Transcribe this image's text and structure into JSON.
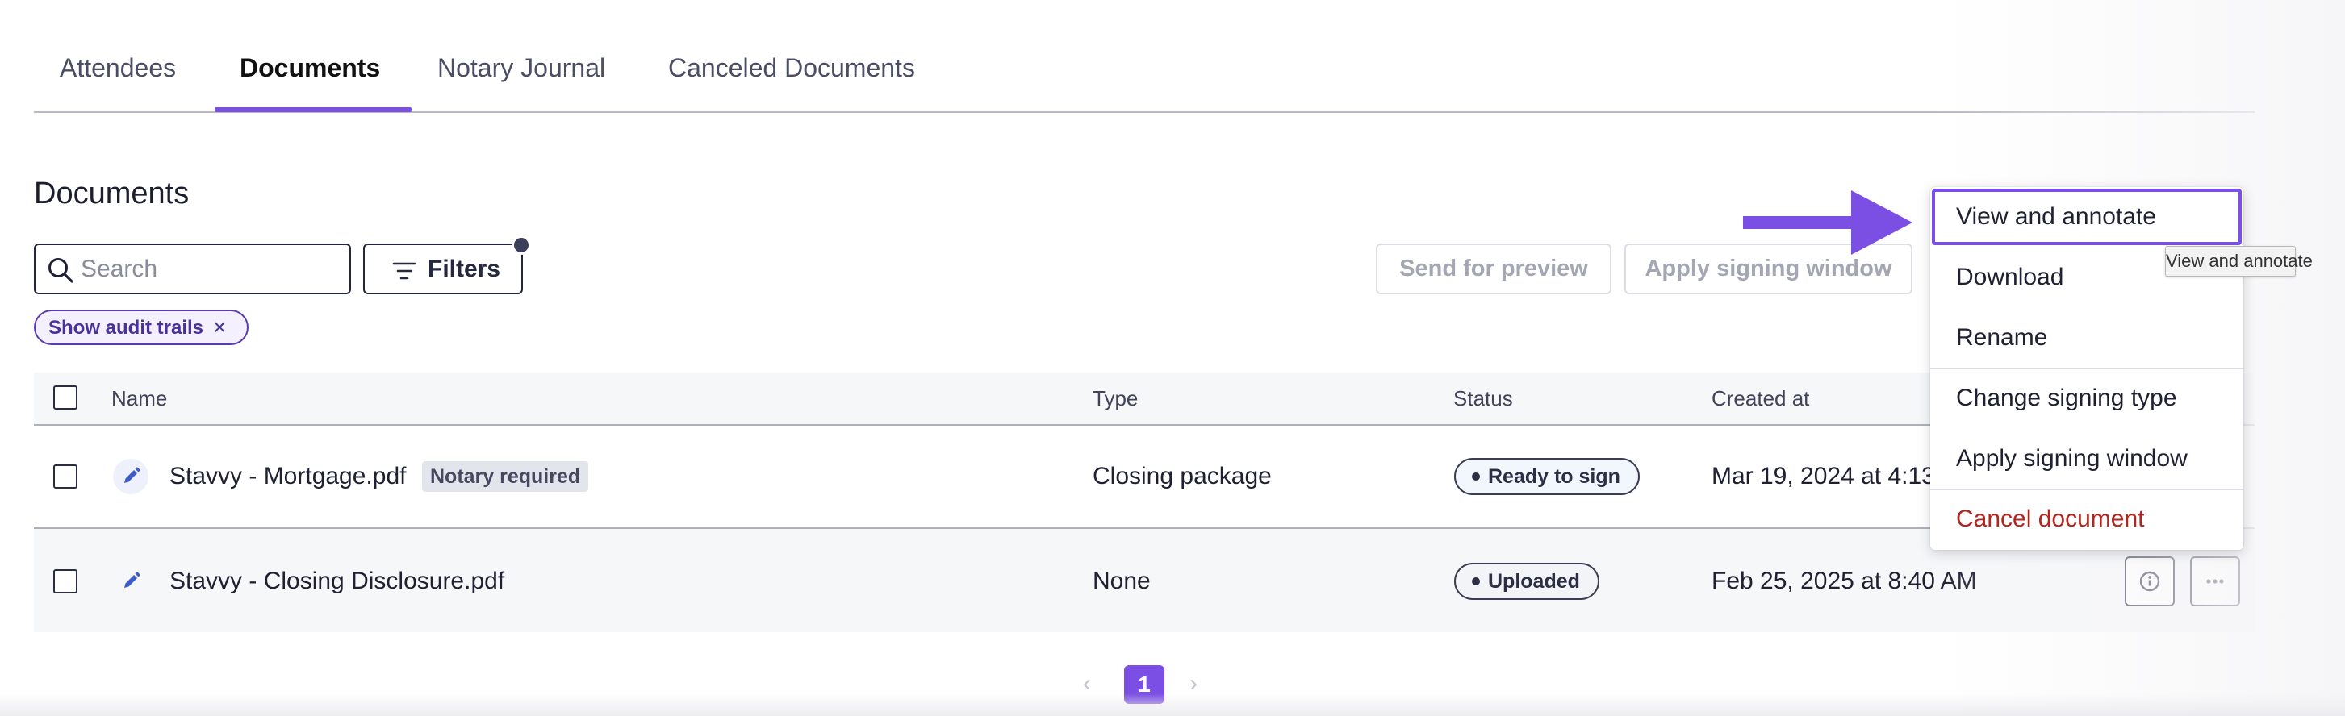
{
  "tabs": [
    {
      "label": "Attendees",
      "active": false
    },
    {
      "label": "Documents",
      "active": true
    },
    {
      "label": "Notary Journal",
      "active": false
    },
    {
      "label": "Canceled Documents",
      "active": false
    }
  ],
  "section": {
    "title": "Documents"
  },
  "search": {
    "placeholder": "Search",
    "value": ""
  },
  "filters": {
    "label": "Filters",
    "has_active_indicator": true
  },
  "chip": {
    "label": "Show audit trails",
    "remove_icon": "close-icon"
  },
  "toolbar": {
    "send_for_preview": "Send for preview",
    "apply_signing_window": "Apply signing window",
    "disabled": true
  },
  "table": {
    "columns": [
      "Name",
      "Type",
      "Status",
      "Created at"
    ],
    "rows": [
      {
        "name": "Stavvy - Mortgage.pdf",
        "tag": "Notary required",
        "type": "Closing package",
        "status": "Ready to sign",
        "created_at": "Mar 19, 2024 at 4:13"
      },
      {
        "name": "Stavvy - Closing Disclosure.pdf",
        "tag": "",
        "type": "None",
        "status": "Uploaded",
        "created_at": "Feb 25, 2025 at 8:40 AM"
      }
    ]
  },
  "pagination": {
    "current_page": "1",
    "prev_icon": "chevron-left-icon",
    "next_icon": "chevron-right-icon"
  },
  "menu": {
    "items": [
      {
        "label": "View and annotate",
        "focused": true
      },
      {
        "label": "Download"
      },
      {
        "label": "Rename"
      },
      {
        "label": "Change signing type"
      },
      {
        "label": "Apply signing window"
      },
      {
        "label": "Cancel document",
        "danger": true
      }
    ]
  },
  "tooltip": {
    "text": "View and annotate"
  },
  "colors": {
    "accent": "#7b4ee4",
    "chip_text": "#47339a",
    "danger": "#b3261e",
    "text": "#1f2133"
  }
}
